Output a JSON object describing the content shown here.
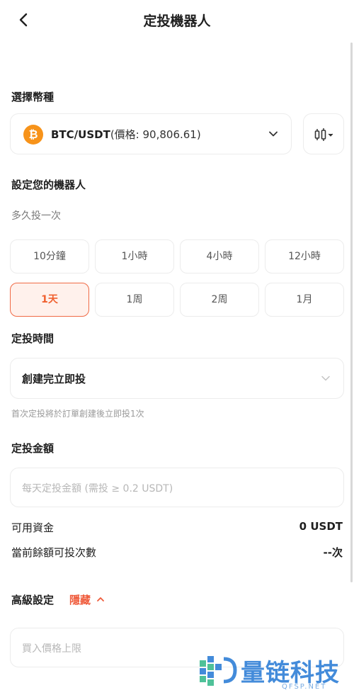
{
  "header": {
    "title": "定投機器人"
  },
  "pair_section": {
    "label": "選擇幣種",
    "coin_symbol": "₿",
    "pair": "BTC/USDT",
    "price_text": "(價格: 90,806.61)"
  },
  "robot_section": {
    "label": "設定您的機器人",
    "freq_label": "多久投一次",
    "options": [
      "10分鐘",
      "1小時",
      "4小時",
      "12小時",
      "1天",
      "1周",
      "2周",
      "1月"
    ],
    "selected": "1天"
  },
  "time_section": {
    "label": "定投時間",
    "value": "創建完立即投",
    "note": "首次定投將於訂單創建後立即投1次"
  },
  "amount_section": {
    "label": "定投金額",
    "placeholder": "每天定投金額 (需投 ≥ 0.2 USDT)",
    "available_label": "可用資金",
    "available_value": "0 USDT",
    "times_label": "當前餘額可投次數",
    "times_value": "--次"
  },
  "advanced": {
    "label": "高級設定",
    "toggle": "隱藏",
    "limit_placeholder": "買入價格上限"
  },
  "watermark": {
    "text": "量链科技",
    "sub": "QFSP.NET"
  },
  "colors": {
    "accent": "#f0602f",
    "btc": "#f7931a",
    "watermark": "#2f7fd6"
  }
}
